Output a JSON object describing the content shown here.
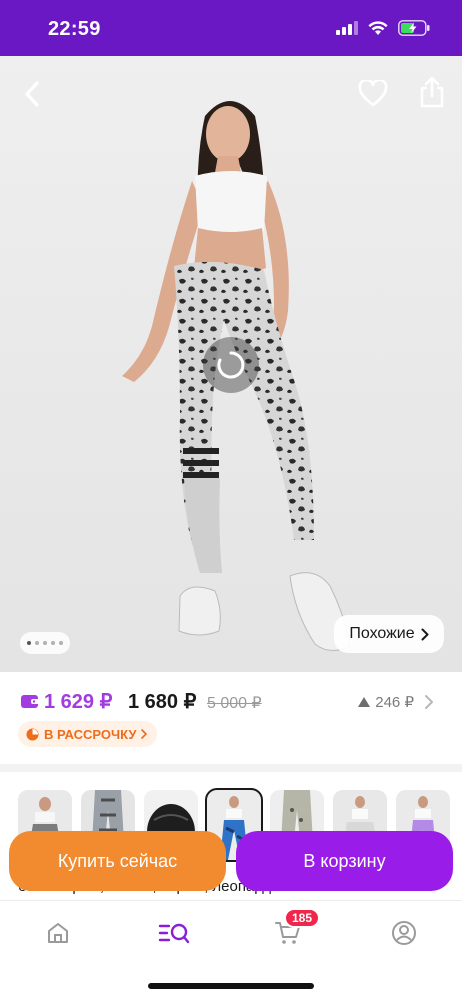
{
  "status_bar": {
    "time": "22:59",
    "icons": [
      "signal-icon",
      "wifi-icon",
      "battery-icon"
    ]
  },
  "product_image": {
    "icons": [
      "back-icon",
      "heart-icon",
      "share-icon"
    ],
    "carousel_dots": 5,
    "carousel_active_index": 0,
    "similar_button": {
      "label": "Похожие",
      "icon": "chevron-right-icon"
    }
  },
  "price": {
    "wallet_price": "1 629 ₽",
    "price": "1 680 ₽",
    "old_price": "5 000 ₽",
    "points": "246 ₽",
    "installment_label": "В РАССРОЧКУ",
    "colors": {
      "wallet": "#a23be0",
      "installment": "#ee6d1a"
    }
  },
  "thumbnails": {
    "count": 7,
    "selected_index": 3
  },
  "description_partial": "бело-серый, белый, серый, леопардовый",
  "actions": {
    "buy_now": "Купить сейчас",
    "add_to_cart": "В корзину",
    "colors": {
      "buy_now": "#f28a2f",
      "add_to_cart": "#9a1ce8"
    }
  },
  "tabbar": {
    "tabs": [
      "home-icon",
      "catalog-search-icon",
      "cart-icon",
      "profile-icon"
    ],
    "active_tab": "catalog-search-icon",
    "cart_badge": "185",
    "accent": "#8a1fd8"
  }
}
